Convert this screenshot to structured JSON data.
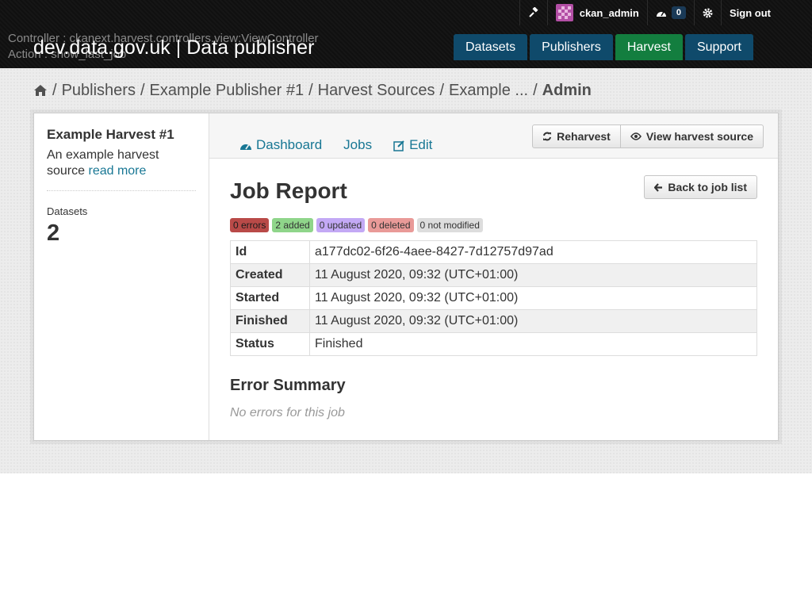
{
  "header": {
    "debug_controller": "Controller : ckanext.harvest.controllers.view:ViewController",
    "debug_action": "Action : show_last_job",
    "site_title": "dev.data.gov.uk | Data publisher",
    "account": {
      "username": "ckan_admin",
      "activity_count": "0",
      "sign_out": "Sign out"
    },
    "nav": [
      {
        "label": "Datasets"
      },
      {
        "label": "Publishers"
      },
      {
        "label": "Harvest"
      },
      {
        "label": "Support"
      }
    ]
  },
  "breadcrumb": {
    "sep": "/",
    "items": [
      "Publishers",
      "Example Publisher #1",
      "Harvest Sources",
      "Example ..."
    ],
    "current": "Admin"
  },
  "sidebar": {
    "title": "Example Harvest #1",
    "description": "An example harvest source",
    "read_more": "read more",
    "datasets_label": "Datasets",
    "datasets_count": "2"
  },
  "tabs": {
    "dashboard": "Dashboard",
    "jobs": "Jobs",
    "edit": "Edit"
  },
  "actions": {
    "reharvest": "Reharvest",
    "view_source": "View harvest source",
    "back": "Back to job list"
  },
  "report": {
    "title": "Job Report",
    "labels": {
      "errors": "0 errors",
      "added": "2 added",
      "updated": "0 updated",
      "deleted": "0 deleted",
      "not_modified": "0 not modified"
    },
    "rows": [
      {
        "key": "Id",
        "value": "a177dc02-6f26-4aee-8427-7d12757d97ad"
      },
      {
        "key": "Created",
        "value": "11 August 2020, 09:32 (UTC+01:00)"
      },
      {
        "key": "Started",
        "value": "11 August 2020, 09:32 (UTC+01:00)"
      },
      {
        "key": "Finished",
        "value": "11 August 2020, 09:32 (UTC+01:00)"
      },
      {
        "key": "Status",
        "value": "Finished"
      }
    ],
    "error_summary_title": "Error Summary",
    "no_errors": "No errors for this job"
  },
  "colors": {
    "masthead": "#121212",
    "nav": "#0f4a6b",
    "nav_active": "#137e3f",
    "link": "#187794"
  }
}
